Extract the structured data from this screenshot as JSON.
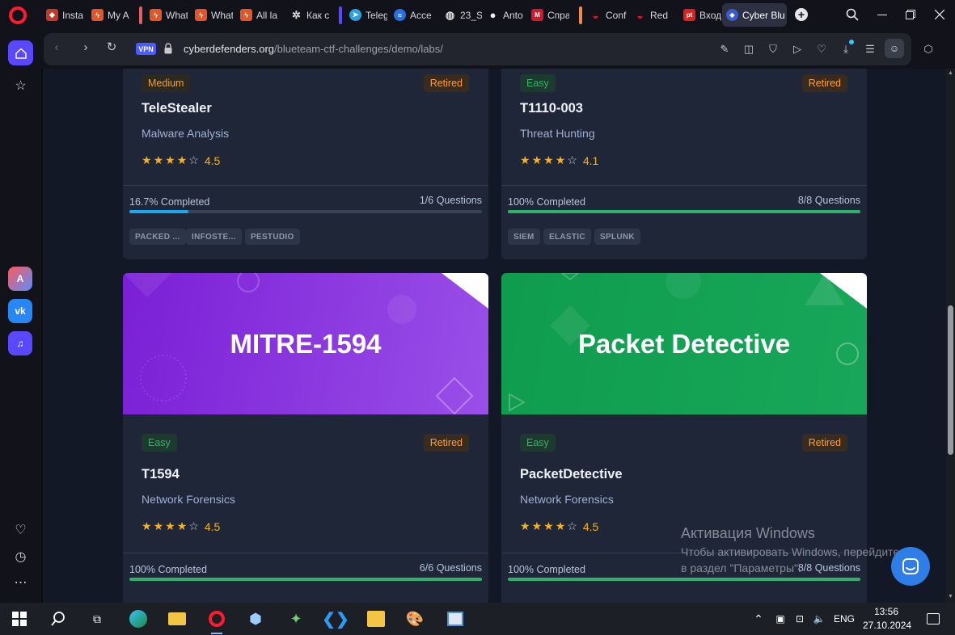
{
  "browser": {
    "tabs": [
      {
        "label": "Insta",
        "color": "#c0392b"
      },
      {
        "label": "My A",
        "color": "#e0582a"
      },
      {
        "label": "What",
        "color": "#e0582a"
      },
      {
        "label": "What",
        "color": "#e0582a"
      },
      {
        "label": "All la",
        "color": "#e0582a"
      },
      {
        "label": "Как с",
        "color": "#444"
      },
      {
        "label": "Teleg",
        "color": "#2aa3e0"
      },
      {
        "label": "Acce",
        "color": "#2a6fe0"
      },
      {
        "label": "23_S",
        "color": "#444"
      },
      {
        "label": "Anto",
        "color": "#333"
      },
      {
        "label": "Спра",
        "color": "#d0192a"
      },
      {
        "label": "Conf",
        "color": "#d0192a"
      },
      {
        "label": "Red",
        "color": "#d0192a"
      },
      {
        "label": "Вход",
        "color": "#e02020"
      },
      {
        "label": "Cyber Blu",
        "color": "#3a5bd0"
      }
    ],
    "address": {
      "vpn_label": "VPN",
      "host": "cyberdefenders.org",
      "path": "/blueteam-ctf-challenges/demo/labs/"
    }
  },
  "labs": [
    {
      "difficulty": "Medium",
      "status": "Retired",
      "title": "TeleStealer",
      "category": "Malware Analysis",
      "stars_full": 4,
      "rating": "4.5",
      "progress_label": "16.7% Completed",
      "progress_fraction": 0.167,
      "progress_color": "#1ea7f0",
      "questions": "1/6 Questions",
      "tags": [
        "PACKED ...",
        "INFOSTE...",
        "PESTUDIO"
      ]
    },
    {
      "difficulty": "Easy",
      "status": "Retired",
      "title": "T1110-003",
      "category": "Threat Hunting",
      "stars_full": 4,
      "rating": "4.1",
      "progress_label": "100% Completed",
      "progress_fraction": 1.0,
      "progress_color": "#2fb06b",
      "questions": "8/8 Questions",
      "tags": [
        "SIEM",
        "ELASTIC",
        "SPLUNK"
      ]
    },
    {
      "banner_text": "MITRE-1594",
      "banner_color": "#8a3be0",
      "difficulty": "Easy",
      "status": "Retired",
      "title": "T1594",
      "category": "Network Forensics",
      "stars_full": 4,
      "rating": "4.5",
      "progress_label": "100% Completed",
      "progress_fraction": 1.0,
      "progress_color": "#2fb06b",
      "questions": "6/6 Questions"
    },
    {
      "banner_text": "Packet Detective",
      "banner_color": "#14a356",
      "difficulty": "Easy",
      "status": "Retired",
      "title": "PacketDetective",
      "category": "Network Forensics",
      "stars_full": 4,
      "rating": "4.5",
      "progress_label": "100% Completed",
      "progress_fraction": 1.0,
      "progress_color": "#2fb06b",
      "questions": "8/8 Questions"
    }
  ],
  "watermark": {
    "title": "Активация Windows",
    "line1": "Чтобы активировать Windows, перейдите",
    "line2": "в раздел \"Параметры\"."
  },
  "taskbar": {
    "language": "ENG",
    "time": "13:56",
    "date": "27.10.2024"
  }
}
